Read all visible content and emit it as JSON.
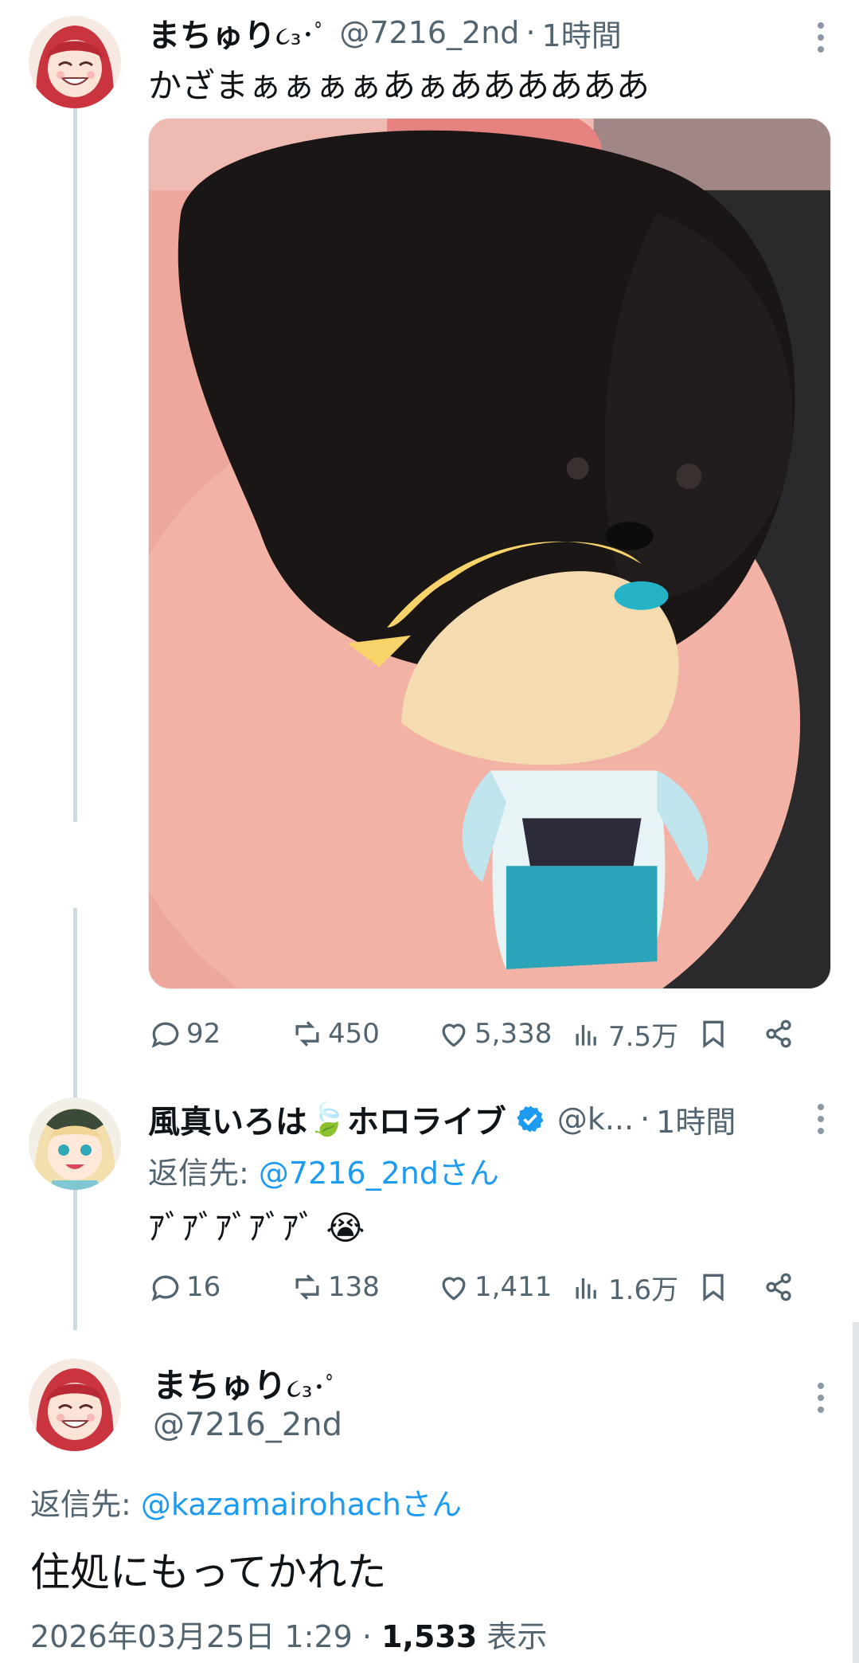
{
  "tweet1": {
    "display_name": "まちゅり",
    "name_emoji": "૮₃･ﾟ",
    "handle": "@7216_2nd",
    "separator": "·",
    "time": "1時間",
    "text": "かざまぁぁぁぁあぁああああああ",
    "avatar_icon": "avatar-red-hair-smiling",
    "media_description_icon": "photo-black-pomeranian-with-plush-doll",
    "stats": {
      "replies": "92",
      "retweets": "450",
      "likes": "5,338",
      "views": "7.5万"
    }
  },
  "tweet2": {
    "display_name": "風真いろは",
    "name_emoji": "🍃",
    "name_suffix": "ホロライブ",
    "verified": true,
    "handle": "@k...",
    "separator": "·",
    "time": "1時間",
    "reply_to_prefix": "返信先: ",
    "reply_to_mention": "@7216_2ndさん",
    "text": "ｱﾞｱﾞｱﾞｱﾞｱﾞ",
    "text_emoji": "😭",
    "avatar_icon": "avatar-blonde-anime-girl",
    "stats": {
      "replies": "16",
      "retweets": "138",
      "likes": "1,411",
      "views": "1.6万"
    }
  },
  "tweet3": {
    "display_name": "まちゅり",
    "name_emoji": "૮₃･ﾟ",
    "handle": "@7216_2nd",
    "reply_to_prefix": "返信先: ",
    "reply_to_mention": "@kazamairohachさん",
    "text": "住処にもってかれた",
    "timestamp": "2026年03月25日 1:29",
    "separator": "·",
    "views_count": "1,533",
    "views_label": "表示",
    "avatar_icon": "avatar-red-hair-smiling"
  },
  "colors": {
    "text": "#0f1419",
    "secondary": "#536471",
    "link": "#1d9bf0",
    "thread_line": "#cfd9de",
    "verified": "#1d9bf0"
  }
}
